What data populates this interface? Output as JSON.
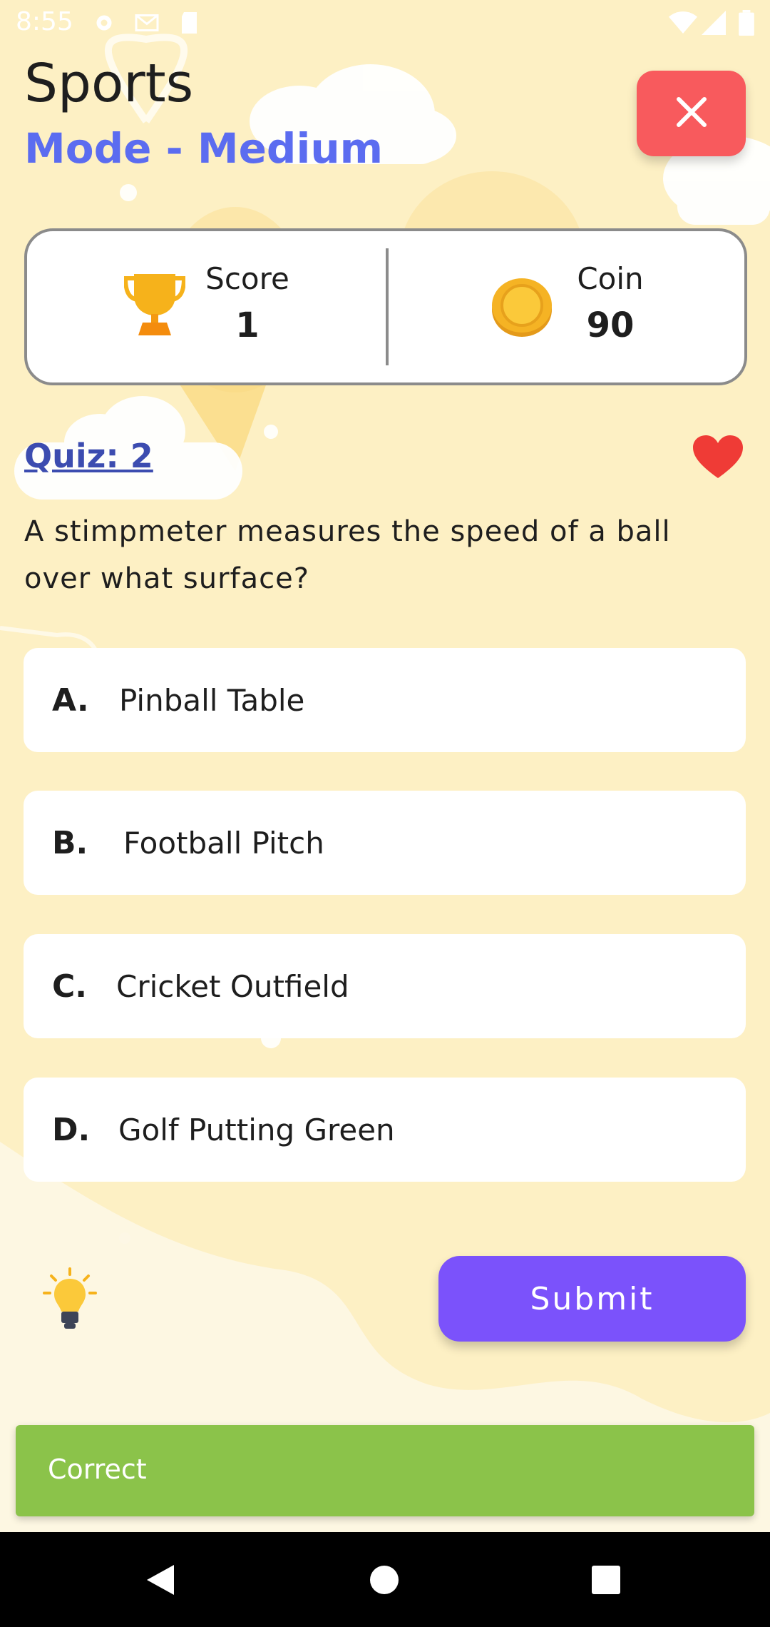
{
  "status_bar": {
    "time": "8:55",
    "icons": [
      "gear-icon",
      "gmail-icon",
      "sd-card-icon",
      "wifi-icon",
      "signal-icon",
      "battery-icon"
    ]
  },
  "header": {
    "category": "Sports",
    "mode": "Mode - Medium",
    "close_icon": "close-icon"
  },
  "stats": {
    "score_label": "Score",
    "score_value": "1",
    "coin_label": "Coin",
    "coin_value": "90"
  },
  "quiz": {
    "number_label": "Quiz: 2",
    "question": "A stimpmeter measures the speed of a ball over what surface?",
    "options": [
      {
        "letter": "A.",
        "text": "Pinball Table"
      },
      {
        "letter": "B.",
        "text": "Football Pitch"
      },
      {
        "letter": "C.",
        "text": "Cricket Outfield"
      },
      {
        "letter": "D.",
        "text": "Golf Putting Green"
      }
    ]
  },
  "actions": {
    "submit_label": "Submit",
    "hint_icon": "lightbulb-icon"
  },
  "snackbar": {
    "message": "Correct"
  },
  "colors": {
    "background": "#fdf0c4",
    "mode_text": "#5b6cf0",
    "close_button": "#f85a5d",
    "quiz_label": "#3c4cb0",
    "heart": "#ef3b36",
    "submit_button": "#7b52fb",
    "snackbar": "#8bc34a"
  }
}
